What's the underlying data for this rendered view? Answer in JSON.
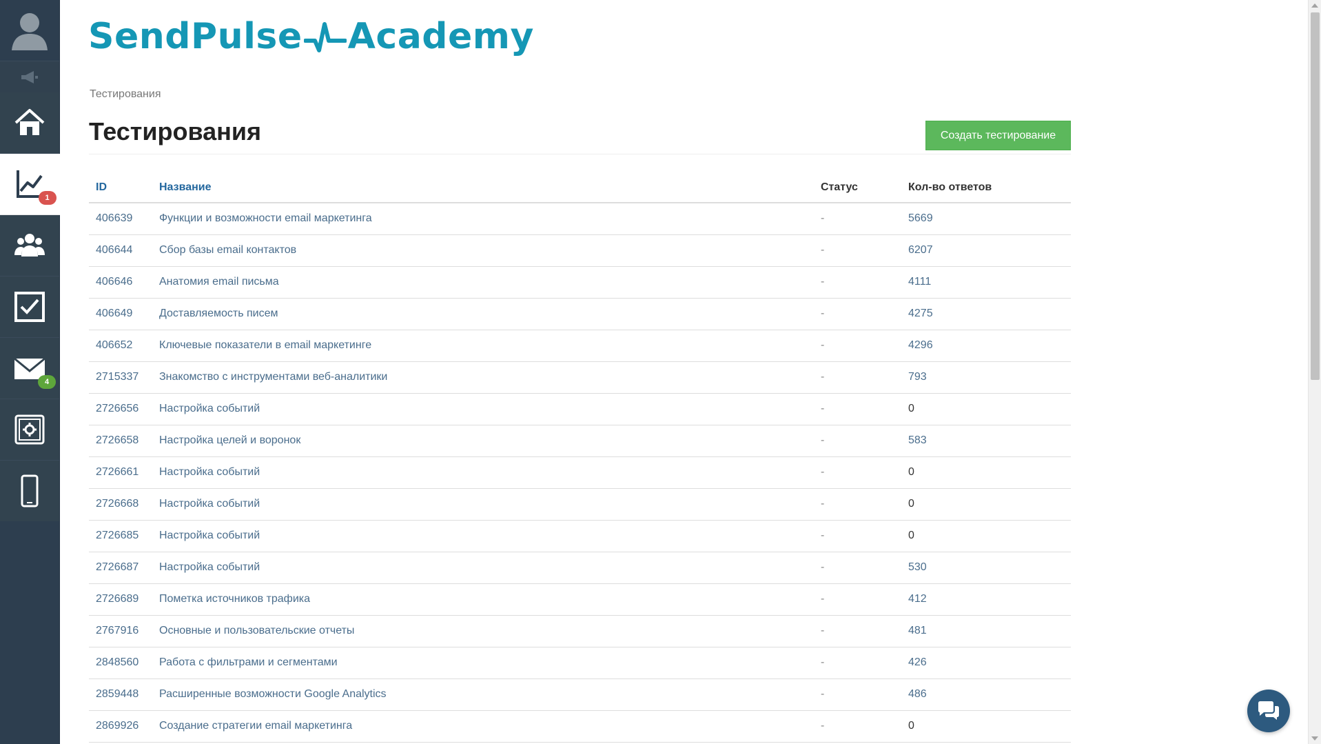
{
  "brand": {
    "name_left": "SendPulse",
    "name_right": "Academy",
    "color": "#1597b5"
  },
  "sidebar": {
    "items": [
      {
        "icon": "home-icon"
      },
      {
        "icon": "analytics-chart-icon",
        "badge": "1",
        "active": true
      },
      {
        "icon": "users-icon"
      },
      {
        "icon": "checkbox-icon"
      },
      {
        "icon": "mail-icon",
        "badge": "4"
      },
      {
        "icon": "settings-safe-icon"
      },
      {
        "icon": "mobile-icon"
      }
    ]
  },
  "breadcrumb": "Тестирования",
  "page_title": "Тестирования",
  "create_button_label": "Создать тестирование",
  "table": {
    "headers": {
      "id": "ID",
      "title": "Название",
      "status": "Статус",
      "answers": "Кол-во ответов"
    },
    "rows": [
      {
        "id": "406639",
        "title": "Функции и возможности email маркетинга",
        "status": "-",
        "answers": "5669"
      },
      {
        "id": "406644",
        "title": "Сбор базы email контактов",
        "status": "-",
        "answers": "6207"
      },
      {
        "id": "406646",
        "title": "Анатомия email письма",
        "status": "-",
        "answers": "4111"
      },
      {
        "id": "406649",
        "title": "Доставляемость писем",
        "status": "-",
        "answers": "4275"
      },
      {
        "id": "406652",
        "title": "Ключевые показатели в email маркетинге",
        "status": "-",
        "answers": "4296"
      },
      {
        "id": "2715337",
        "title": "Знакомство с инструментами веб-аналитики",
        "status": "-",
        "answers": "793"
      },
      {
        "id": "2726656",
        "title": "Настройка событий",
        "status": "-",
        "answers": "0"
      },
      {
        "id": "2726658",
        "title": "Настройка целей и воронок",
        "status": "-",
        "answers": "583"
      },
      {
        "id": "2726661",
        "title": "Настройка событий",
        "status": "-",
        "answers": "0"
      },
      {
        "id": "2726668",
        "title": "Настройка событий",
        "status": "-",
        "answers": "0"
      },
      {
        "id": "2726685",
        "title": "Настройка событий",
        "status": "-",
        "answers": "0"
      },
      {
        "id": "2726687",
        "title": "Настройка событий",
        "status": "-",
        "answers": "530"
      },
      {
        "id": "2726689",
        "title": "Пометка источников трафика",
        "status": "-",
        "answers": "412"
      },
      {
        "id": "2767916",
        "title": "Основные и пользовательские отчеты",
        "status": "-",
        "answers": "481"
      },
      {
        "id": "2848560",
        "title": "Работа с фильтрами и сегментами",
        "status": "-",
        "answers": "426"
      },
      {
        "id": "2859448",
        "title": "Расширенные возможности Google Analytics",
        "status": "-",
        "answers": "486"
      },
      {
        "id": "2869926",
        "title": "Создание стратегии email маркетинга",
        "status": "-",
        "answers": "0"
      }
    ]
  },
  "chat_icon": "chat-bubbles-icon"
}
